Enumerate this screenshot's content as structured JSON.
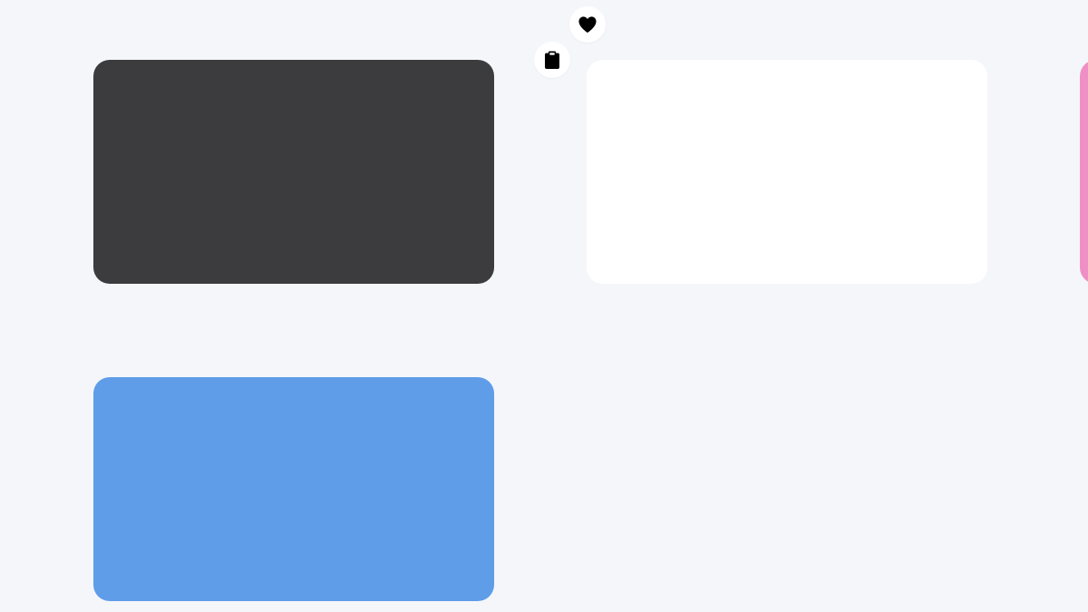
{
  "colors": {
    "background": "#f4f6fa",
    "card_dark": "#3c3c3f",
    "card_white": "#ffffff",
    "card_pink": "#ef90c4",
    "card_blue": "#5f9de9",
    "icon_button_bg": "#ffffff",
    "icon_glyph": "#000000"
  },
  "icons": {
    "favorite": "heart-icon",
    "clipboard": "clipboard-icon"
  }
}
